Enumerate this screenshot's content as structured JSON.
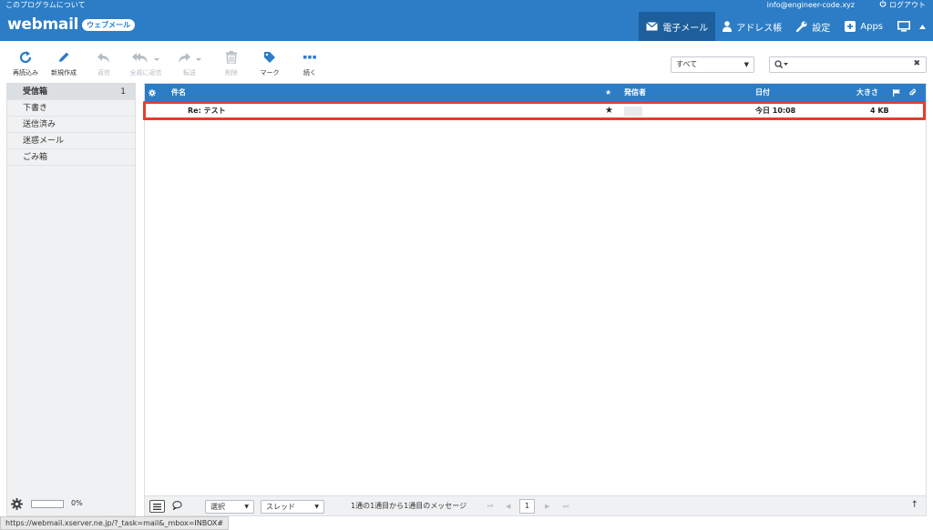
{
  "header": {
    "about_link": "このプログラムについて",
    "user_email": "info@engineer-code.xyz",
    "logout": "ログアウト",
    "logo_text": "webmail",
    "logo_badge": "ウェブメール"
  },
  "nav": {
    "mail": "電子メール",
    "contacts": "アドレス帳",
    "settings": "設定",
    "apps": "Apps"
  },
  "toolbar": {
    "reload": "再読込み",
    "compose": "新規作成",
    "reply": "返信",
    "reply_all": "全員に返信",
    "forward": "転送",
    "delete": "削除",
    "mark": "マーク",
    "more": "続く"
  },
  "filter": {
    "selected": "すべて"
  },
  "search": {
    "value": ""
  },
  "folders": [
    {
      "name": "受信箱",
      "count": "1"
    },
    {
      "name": "下書き"
    },
    {
      "name": "送信済み"
    },
    {
      "name": "迷惑メール"
    },
    {
      "name": "ごみ箱"
    }
  ],
  "quota": {
    "text": "0%",
    "percent": 0
  },
  "list": {
    "columns": {
      "subject": "件名",
      "sender": "発信者",
      "date": "日付",
      "size": "大きさ"
    },
    "rows": [
      {
        "subject": "Re: テスト",
        "date": "今日 10:08",
        "size": "4 KB"
      }
    ]
  },
  "footer": {
    "select_label": "選択",
    "thread_label": "スレッド",
    "count_text": "1通の1通目から1通目のメッセージ",
    "page": "1"
  },
  "status_url": "https://webmail.xserver.ne.jp/?_task=mail&_mbox=INBOX#",
  "colors": {
    "accent": "#2c7dc6",
    "highlight": "#e43e2b"
  }
}
